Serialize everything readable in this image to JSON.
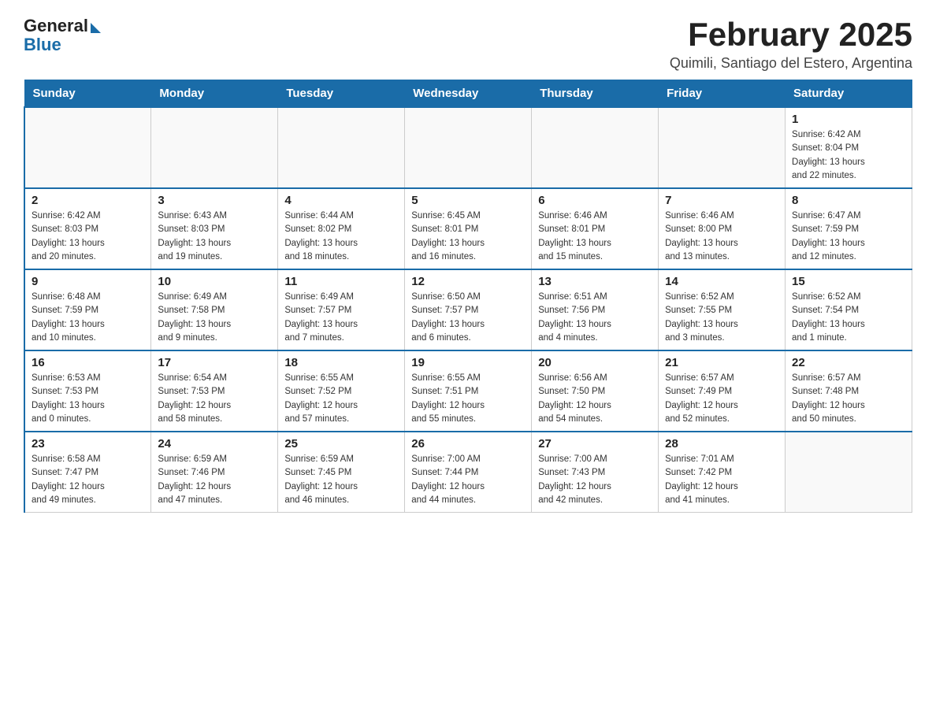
{
  "header": {
    "logo_general": "General",
    "logo_blue": "Blue",
    "title": "February 2025",
    "subtitle": "Quimili, Santiago del Estero, Argentina"
  },
  "weekdays": [
    "Sunday",
    "Monday",
    "Tuesday",
    "Wednesday",
    "Thursday",
    "Friday",
    "Saturday"
  ],
  "weeks": [
    [
      {
        "day": "",
        "info": ""
      },
      {
        "day": "",
        "info": ""
      },
      {
        "day": "",
        "info": ""
      },
      {
        "day": "",
        "info": ""
      },
      {
        "day": "",
        "info": ""
      },
      {
        "day": "",
        "info": ""
      },
      {
        "day": "1",
        "info": "Sunrise: 6:42 AM\nSunset: 8:04 PM\nDaylight: 13 hours\nand 22 minutes."
      }
    ],
    [
      {
        "day": "2",
        "info": "Sunrise: 6:42 AM\nSunset: 8:03 PM\nDaylight: 13 hours\nand 20 minutes."
      },
      {
        "day": "3",
        "info": "Sunrise: 6:43 AM\nSunset: 8:03 PM\nDaylight: 13 hours\nand 19 minutes."
      },
      {
        "day": "4",
        "info": "Sunrise: 6:44 AM\nSunset: 8:02 PM\nDaylight: 13 hours\nand 18 minutes."
      },
      {
        "day": "5",
        "info": "Sunrise: 6:45 AM\nSunset: 8:01 PM\nDaylight: 13 hours\nand 16 minutes."
      },
      {
        "day": "6",
        "info": "Sunrise: 6:46 AM\nSunset: 8:01 PM\nDaylight: 13 hours\nand 15 minutes."
      },
      {
        "day": "7",
        "info": "Sunrise: 6:46 AM\nSunset: 8:00 PM\nDaylight: 13 hours\nand 13 minutes."
      },
      {
        "day": "8",
        "info": "Sunrise: 6:47 AM\nSunset: 7:59 PM\nDaylight: 13 hours\nand 12 minutes."
      }
    ],
    [
      {
        "day": "9",
        "info": "Sunrise: 6:48 AM\nSunset: 7:59 PM\nDaylight: 13 hours\nand 10 minutes."
      },
      {
        "day": "10",
        "info": "Sunrise: 6:49 AM\nSunset: 7:58 PM\nDaylight: 13 hours\nand 9 minutes."
      },
      {
        "day": "11",
        "info": "Sunrise: 6:49 AM\nSunset: 7:57 PM\nDaylight: 13 hours\nand 7 minutes."
      },
      {
        "day": "12",
        "info": "Sunrise: 6:50 AM\nSunset: 7:57 PM\nDaylight: 13 hours\nand 6 minutes."
      },
      {
        "day": "13",
        "info": "Sunrise: 6:51 AM\nSunset: 7:56 PM\nDaylight: 13 hours\nand 4 minutes."
      },
      {
        "day": "14",
        "info": "Sunrise: 6:52 AM\nSunset: 7:55 PM\nDaylight: 13 hours\nand 3 minutes."
      },
      {
        "day": "15",
        "info": "Sunrise: 6:52 AM\nSunset: 7:54 PM\nDaylight: 13 hours\nand 1 minute."
      }
    ],
    [
      {
        "day": "16",
        "info": "Sunrise: 6:53 AM\nSunset: 7:53 PM\nDaylight: 13 hours\nand 0 minutes."
      },
      {
        "day": "17",
        "info": "Sunrise: 6:54 AM\nSunset: 7:53 PM\nDaylight: 12 hours\nand 58 minutes."
      },
      {
        "day": "18",
        "info": "Sunrise: 6:55 AM\nSunset: 7:52 PM\nDaylight: 12 hours\nand 57 minutes."
      },
      {
        "day": "19",
        "info": "Sunrise: 6:55 AM\nSunset: 7:51 PM\nDaylight: 12 hours\nand 55 minutes."
      },
      {
        "day": "20",
        "info": "Sunrise: 6:56 AM\nSunset: 7:50 PM\nDaylight: 12 hours\nand 54 minutes."
      },
      {
        "day": "21",
        "info": "Sunrise: 6:57 AM\nSunset: 7:49 PM\nDaylight: 12 hours\nand 52 minutes."
      },
      {
        "day": "22",
        "info": "Sunrise: 6:57 AM\nSunset: 7:48 PM\nDaylight: 12 hours\nand 50 minutes."
      }
    ],
    [
      {
        "day": "23",
        "info": "Sunrise: 6:58 AM\nSunset: 7:47 PM\nDaylight: 12 hours\nand 49 minutes."
      },
      {
        "day": "24",
        "info": "Sunrise: 6:59 AM\nSunset: 7:46 PM\nDaylight: 12 hours\nand 47 minutes."
      },
      {
        "day": "25",
        "info": "Sunrise: 6:59 AM\nSunset: 7:45 PM\nDaylight: 12 hours\nand 46 minutes."
      },
      {
        "day": "26",
        "info": "Sunrise: 7:00 AM\nSunset: 7:44 PM\nDaylight: 12 hours\nand 44 minutes."
      },
      {
        "day": "27",
        "info": "Sunrise: 7:00 AM\nSunset: 7:43 PM\nDaylight: 12 hours\nand 42 minutes."
      },
      {
        "day": "28",
        "info": "Sunrise: 7:01 AM\nSunset: 7:42 PM\nDaylight: 12 hours\nand 41 minutes."
      },
      {
        "day": "",
        "info": ""
      }
    ]
  ]
}
